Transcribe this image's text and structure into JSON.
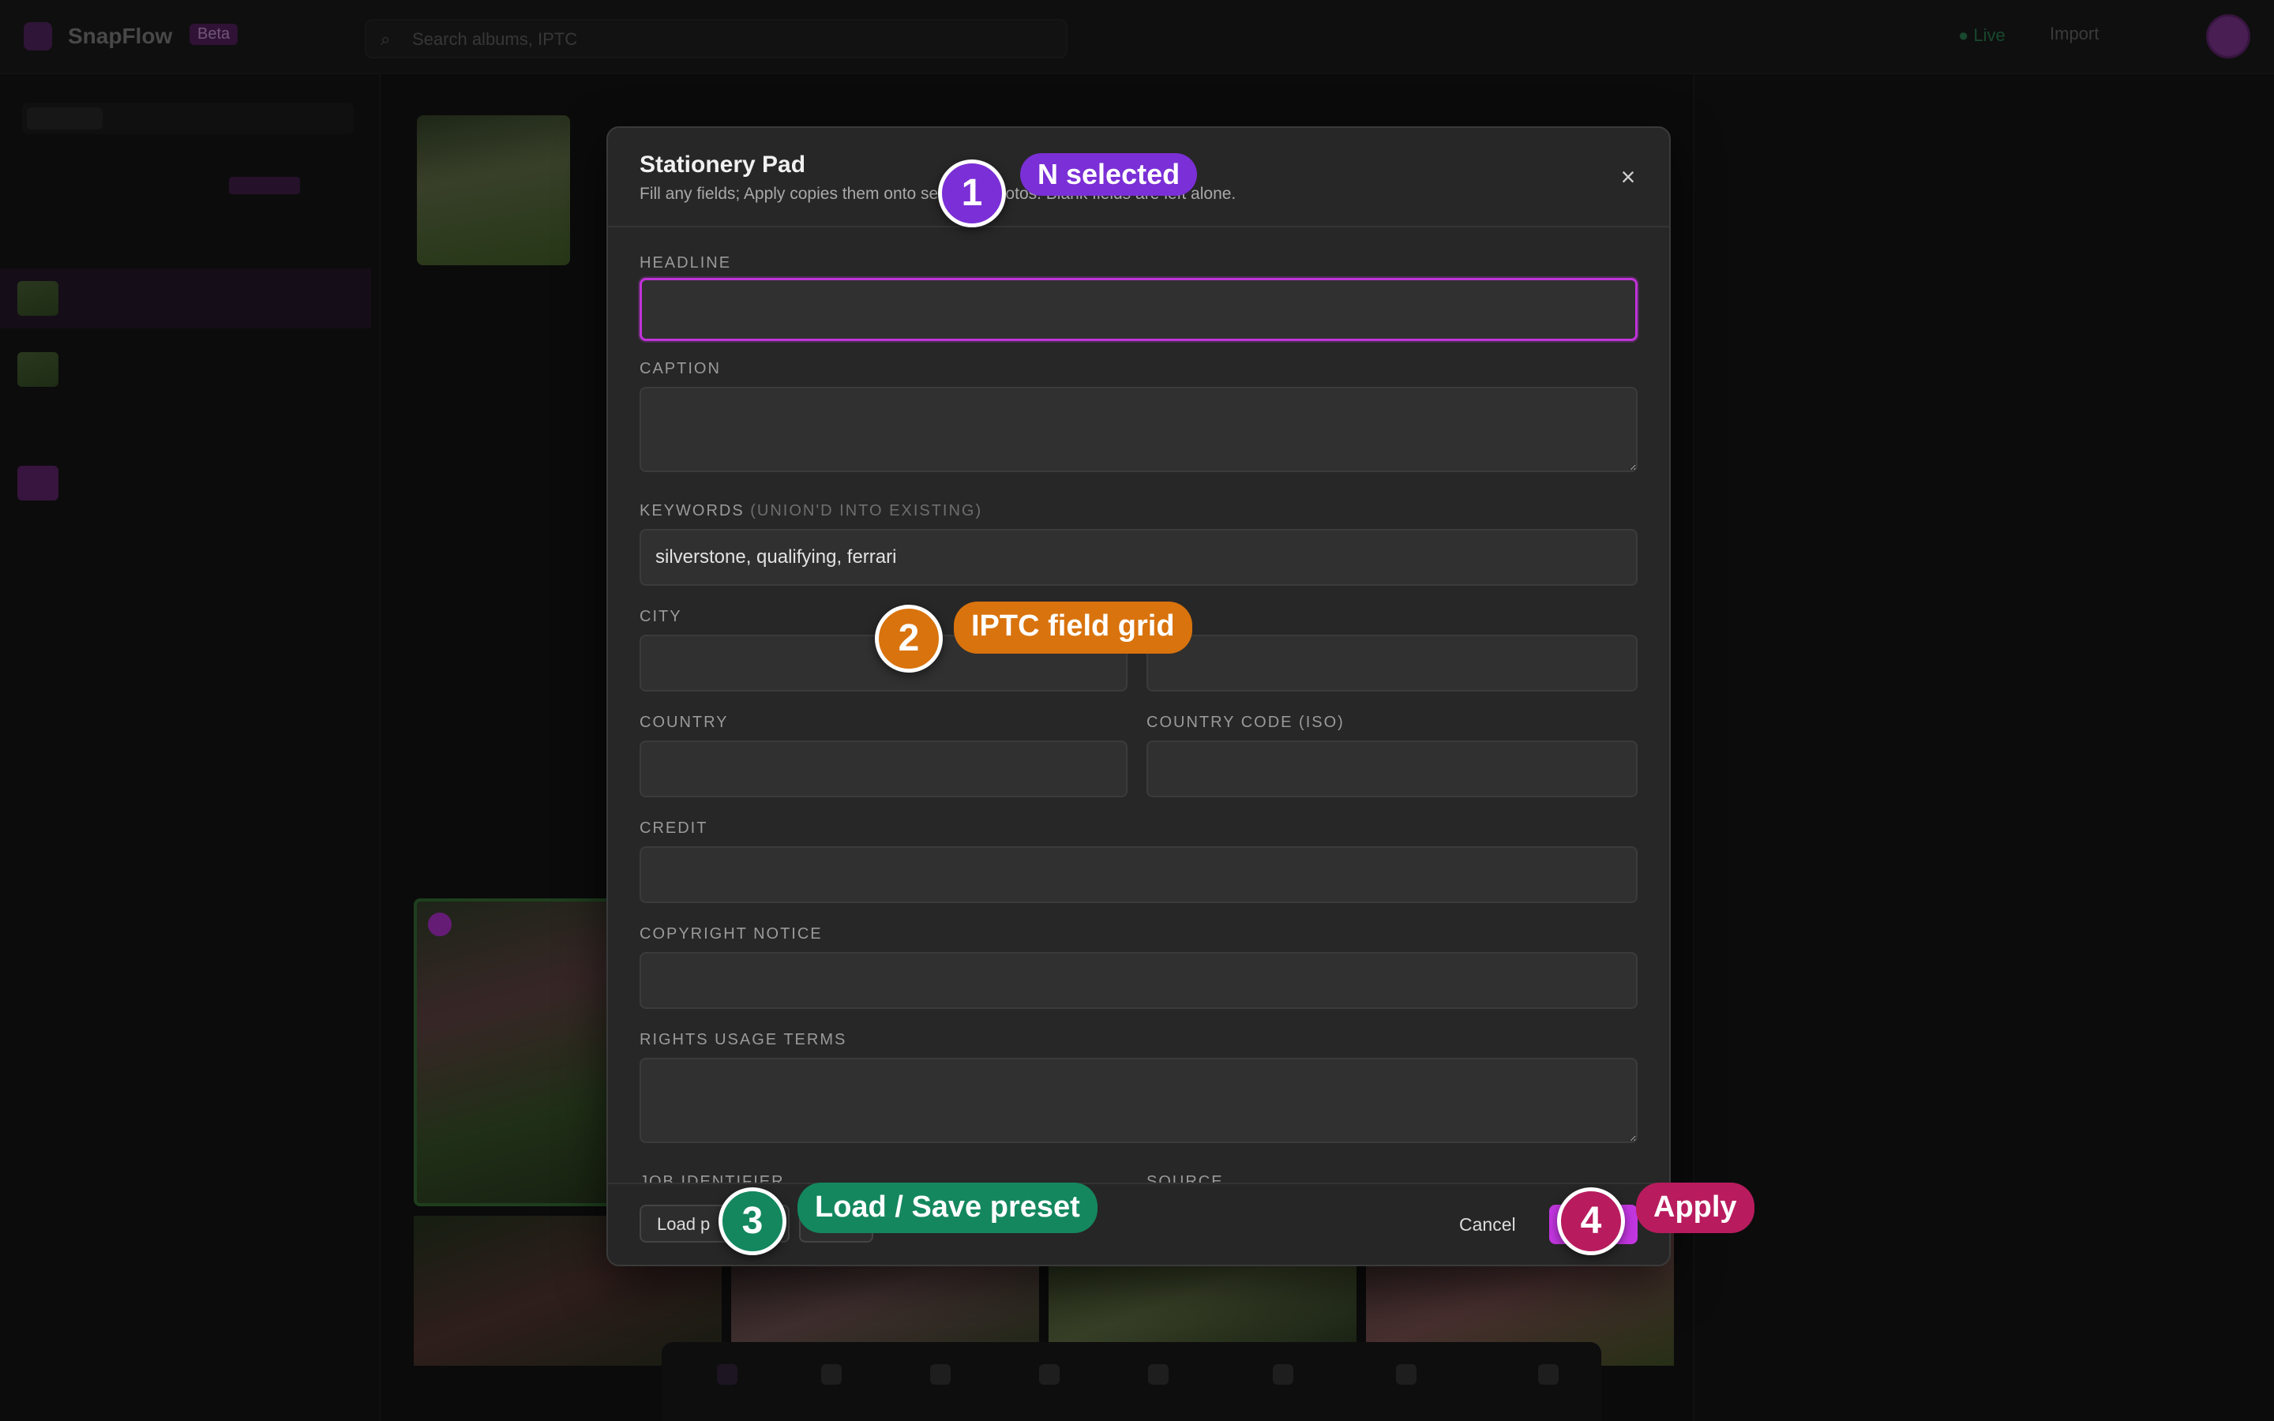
{
  "app": {
    "name": "SnapFlow",
    "badge": "Beta",
    "search_placeholder": "Search albums, IPTC",
    "status": "● Live",
    "header_action": "Import"
  },
  "modal": {
    "title": "Stationery Pad",
    "subtitle": "Fill any fields; Apply copies them onto selected photos. Blank fields are left alone.",
    "close_label": "×",
    "fields": {
      "headline": {
        "label": "HEADLINE",
        "value": ""
      },
      "caption": {
        "label": "CAPTION",
        "value": ""
      },
      "keywords": {
        "label": "KEYWORDS",
        "hint": "(UNION'D INTO EXISTING)",
        "value": "silverstone, qualifying, ferrari"
      },
      "city": {
        "label": "CITY",
        "value": ""
      },
      "state": {
        "label": "",
        "value": ""
      },
      "country": {
        "label": "COUNTRY",
        "value": ""
      },
      "country_code": {
        "label": "COUNTRY CODE (ISO)",
        "value": ""
      },
      "credit": {
        "label": "CREDIT",
        "value": ""
      },
      "copyright": {
        "label": "COPYRIGHT NOTICE",
        "value": ""
      },
      "rights": {
        "label": "RIGHTS USAGE TERMS",
        "value": ""
      },
      "job_identifier": {
        "label": "JOB IDENTIFIER"
      },
      "source": {
        "label": "SOURCE"
      }
    },
    "footer": {
      "load_preset": "Load p",
      "save_preset": "Save",
      "cancel": "Cancel"
    }
  },
  "annotations": [
    {
      "number": "1",
      "label": "N selected",
      "color": "#7b2fd6"
    },
    {
      "number": "2",
      "label": "IPTC field grid",
      "color": "#d9730d"
    },
    {
      "number": "3",
      "label": "Load / Save preset",
      "color": "#14875f"
    },
    {
      "number": "4",
      "label": "Apply",
      "color": "#b81c5e"
    }
  ]
}
